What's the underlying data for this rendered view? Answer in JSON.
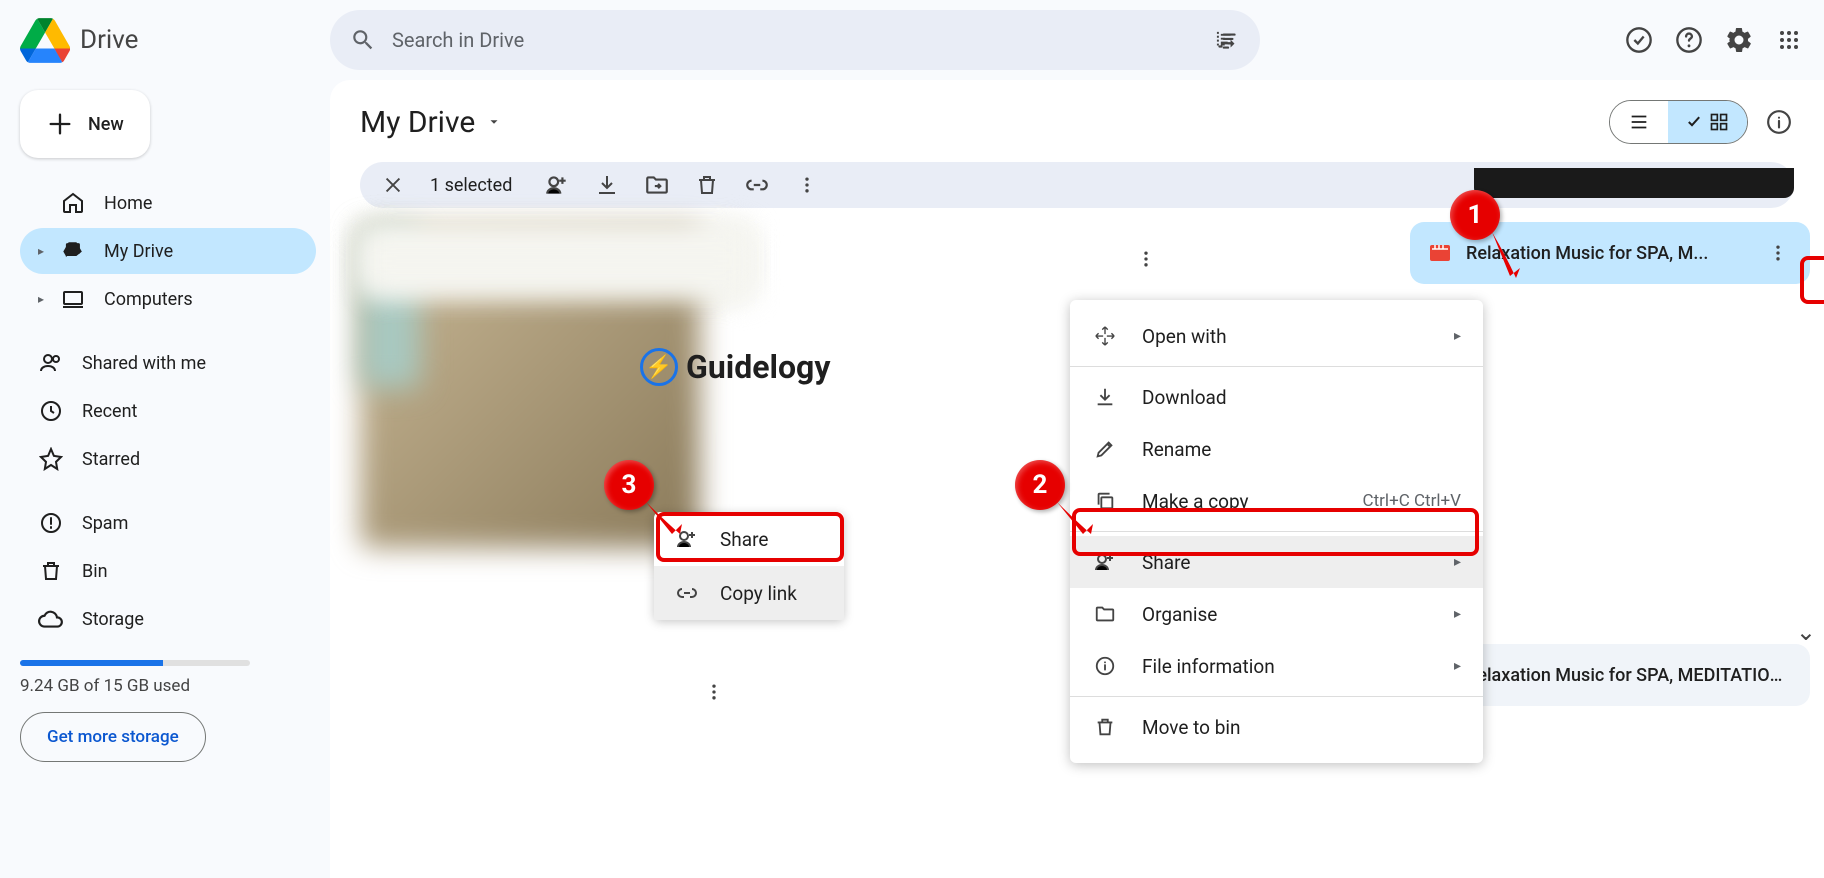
{
  "header": {
    "app_title": "Drive",
    "search_placeholder": "Search in Drive"
  },
  "sidebar": {
    "new_label": "New",
    "items": [
      {
        "label": "Home",
        "icon": "home"
      },
      {
        "label": "My Drive",
        "icon": "drive",
        "active": true,
        "expandable": true
      },
      {
        "label": "Computers",
        "icon": "computer",
        "expandable": true
      }
    ],
    "items2": [
      {
        "label": "Shared with me",
        "icon": "people"
      },
      {
        "label": "Recent",
        "icon": "clock"
      },
      {
        "label": "Starred",
        "icon": "star"
      }
    ],
    "items3": [
      {
        "label": "Spam",
        "icon": "spam"
      },
      {
        "label": "Bin",
        "icon": "trash"
      },
      {
        "label": "Storage",
        "icon": "cloud"
      }
    ],
    "storage_text": "9.24 GB of 15 GB used",
    "storage_btn": "Get more storage"
  },
  "content": {
    "breadcrumb": "My Drive",
    "selection": "1 selected",
    "selected_file": "Relaxation Music for SPA, M...",
    "bottom_file": "Relaxation Music for SPA, MEDITATION..."
  },
  "menu": {
    "open_with": "Open with",
    "download": "Download",
    "rename": "Rename",
    "make_copy": "Make a copy",
    "copy_shortcut": "Ctrl+C Ctrl+V",
    "share": "Share",
    "organise": "Organise",
    "file_info": "File information",
    "move_bin": "Move to bin"
  },
  "submenu": {
    "share": "Share",
    "copy_link": "Copy link"
  },
  "watermark": "Guidelogy",
  "annotations": {
    "a1": "1",
    "a2": "2",
    "a3": "3"
  }
}
